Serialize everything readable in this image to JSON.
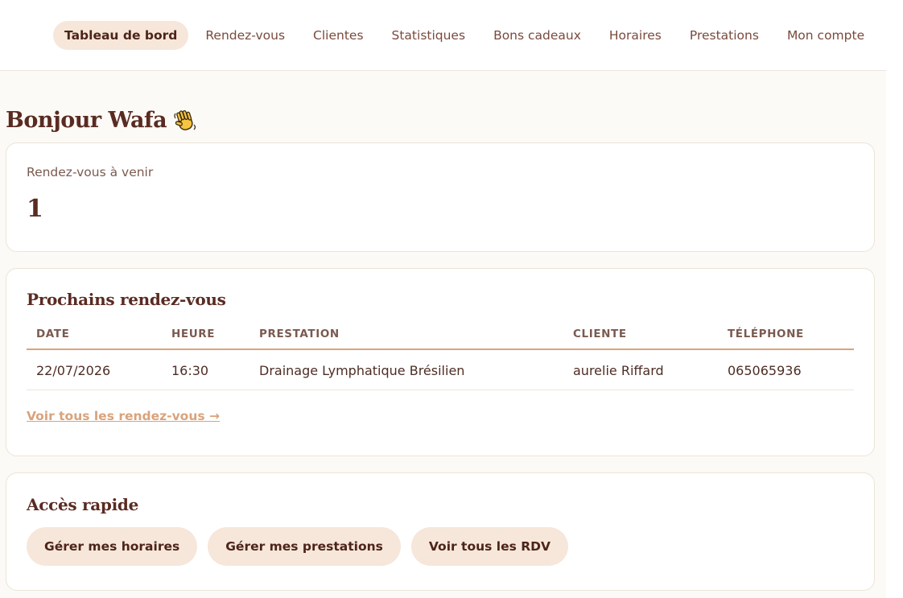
{
  "nav": {
    "items": [
      {
        "label": "Tableau de bord",
        "active": true
      },
      {
        "label": "Rendez-vous"
      },
      {
        "label": "Clientes"
      },
      {
        "label": "Statistiques"
      },
      {
        "label": "Bons cadeaux"
      },
      {
        "label": "Horaires"
      },
      {
        "label": "Prestations"
      },
      {
        "label": "Mon compte"
      }
    ]
  },
  "greeting": {
    "text": "Bonjour Wafa",
    "emoji": "waving-hand-icon"
  },
  "stat": {
    "label": "Rendez-vous à venir",
    "value": "1"
  },
  "upcoming": {
    "title": "Prochains rendez-vous",
    "columns": [
      "DATE",
      "HEURE",
      "PRESTATION",
      "CLIENTE",
      "TÉLÉPHONE"
    ],
    "rows": [
      [
        "22/07/2026",
        "16:30",
        "Drainage Lymphatique Brésilien",
        "aurelie Riffard",
        "065065936"
      ]
    ],
    "link": "Voir tous les rendez-vous →"
  },
  "quick": {
    "title": "Accès rapide",
    "buttons": [
      "Gérer mes horaires",
      "Gérer mes prestations",
      "Voir tous les RDV"
    ]
  },
  "colors": {
    "accent": "#d9a37c",
    "pill": "#f6e7da",
    "heading": "#5a2b22"
  }
}
